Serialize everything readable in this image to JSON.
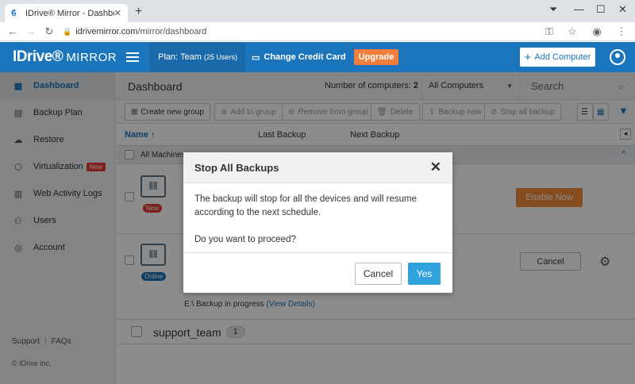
{
  "browser": {
    "tab_title": "IDrive® Mirror - Dashboard",
    "url_host": "idrivemirror.com",
    "url_path": "/mirror/dashboard"
  },
  "header": {
    "logo": "IDrive®",
    "logo_suffix": "MIRROR",
    "plan_label": "Plan: Team",
    "plan_users": "(25 Users)",
    "change_card": "Change Credit Card",
    "upgrade": "Upgrade",
    "add_computer": "Add Computer"
  },
  "sidebar": {
    "items": [
      {
        "label": "Dashboard",
        "icon": "grid-icon"
      },
      {
        "label": "Backup Plan",
        "icon": "calendar-icon"
      },
      {
        "label": "Restore",
        "icon": "cloud-icon"
      },
      {
        "label": "Virtualization",
        "icon": "cube-icon",
        "badge": "New"
      },
      {
        "label": "Web Activity Logs",
        "icon": "log-icon"
      },
      {
        "label": "Users",
        "icon": "users-icon"
      },
      {
        "label": "Account",
        "icon": "account-icon"
      }
    ],
    "support": "Support",
    "faqs": "FAQs",
    "copyright": "© IDrive Inc."
  },
  "dashboard": {
    "title": "Dashboard",
    "num_computers_label": "Number of computers:",
    "num_computers": "2",
    "filter": "All Computers",
    "search_placeholder": "Search"
  },
  "toolbar": {
    "create_group": "Create new group",
    "add_to_group": "Add to group",
    "remove_from_group": "Remove from group",
    "delete": "Delete",
    "backup_now": "Backup now",
    "stop_all_backup": "Stop all backup"
  },
  "table": {
    "col_name": "Name ↑",
    "col_last_backup": "Last Backup",
    "col_next_backup": "Next Backup",
    "all_machines": "All Machines",
    "rows": [
      {
        "status": "New",
        "status_color": "#e53935",
        "action": "Enable Now"
      },
      {
        "status": "Online",
        "status_color": "#1b75bc",
        "action": "Cancel"
      }
    ],
    "progress_text": "E:\\ Backup in progress",
    "progress_link": "(View Details)",
    "group_name": "support_team",
    "group_count": "1"
  },
  "modal": {
    "title": "Stop All Backups",
    "message": "The backup will stop for all the devices and will resume according to the next schedule.",
    "question": "Do you want to proceed?",
    "cancel": "Cancel",
    "yes": "Yes"
  }
}
